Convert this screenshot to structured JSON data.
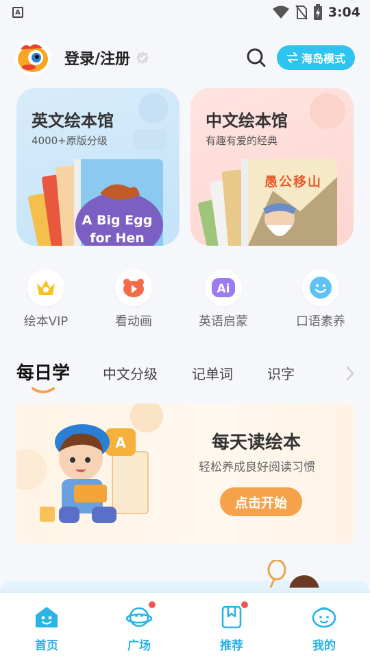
{
  "status_bar": {
    "time": "3:04",
    "notification_icon": "A"
  },
  "header": {
    "login_label": "登录/注册",
    "mode_label": "海岛模式",
    "icons": [
      "mascot-avatar-icon",
      "verified-check-icon",
      "search-icon",
      "switch-arrows-icon"
    ]
  },
  "cards": [
    {
      "title": "英文绘本馆",
      "subtitle": "4000+原版分级",
      "book_text": "A Big Egg for Hen"
    },
    {
      "title": "中文绘本馆",
      "subtitle": "有趣有爱的经典",
      "book_text": "愚公移山"
    }
  ],
  "quick_entries": [
    {
      "label": "绘本VIP",
      "icon": "crown-icon"
    },
    {
      "label": "看动画",
      "icon": "bear-play-icon"
    },
    {
      "label": "英语启蒙",
      "icon": "ai-icon"
    },
    {
      "label": "口语素养",
      "icon": "smile-face-icon"
    }
  ],
  "tabs": [
    "每日学",
    "中文分级",
    "记单词",
    "识字"
  ],
  "active_tab": "每日学",
  "banner": {
    "title": "每天读绘本",
    "subtitle": "轻松养成良好阅读习惯",
    "button_label": "点击开始",
    "badge_letter": "A"
  },
  "bottom_nav": [
    {
      "label": "首页",
      "icon": "home-face-icon",
      "active": true,
      "dot": false
    },
    {
      "label": "广场",
      "icon": "planet-face-icon",
      "active": false,
      "dot": true
    },
    {
      "label": "推荐",
      "icon": "bookmark-icon",
      "active": false,
      "dot": true
    },
    {
      "label": "我的",
      "icon": "profile-face-icon",
      "active": false,
      "dot": false
    }
  ],
  "colors": {
    "accent": "#2ec3f0",
    "button_orange": "#f6a24a",
    "nav_active": "#29b3e6",
    "badge_red": "#f25757"
  }
}
